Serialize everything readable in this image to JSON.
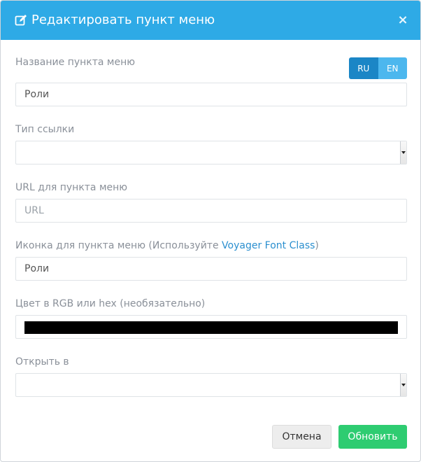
{
  "header": {
    "title": "Редактировать пункт меню",
    "title_icon": "edit-icon",
    "close_glyph": "×",
    "color": "#2eaae6"
  },
  "lang_switch": {
    "options": [
      "RU",
      "EN"
    ],
    "active": "RU"
  },
  "form": {
    "title_label": "Название пункта меню",
    "title_value": "Роли",
    "link_type_label": "Тип ссылки",
    "link_type_value": "",
    "url_label": "URL для пункта меню",
    "url_placeholder": "URL",
    "url_value": "",
    "icon_label_prefix": "Иконка для пункта меню (Используйте ",
    "icon_label_link": "Voyager Font Class",
    "icon_label_suffix": ")",
    "icon_value": "Роли",
    "color_label": "Цвет в RGB или hex (необязательно)",
    "color_value": "#000000",
    "target_label": "Открыть в",
    "target_value": ""
  },
  "footer": {
    "cancel_label": "Отмена",
    "update_label": "Обновить",
    "update_color": "#2ecc71"
  }
}
